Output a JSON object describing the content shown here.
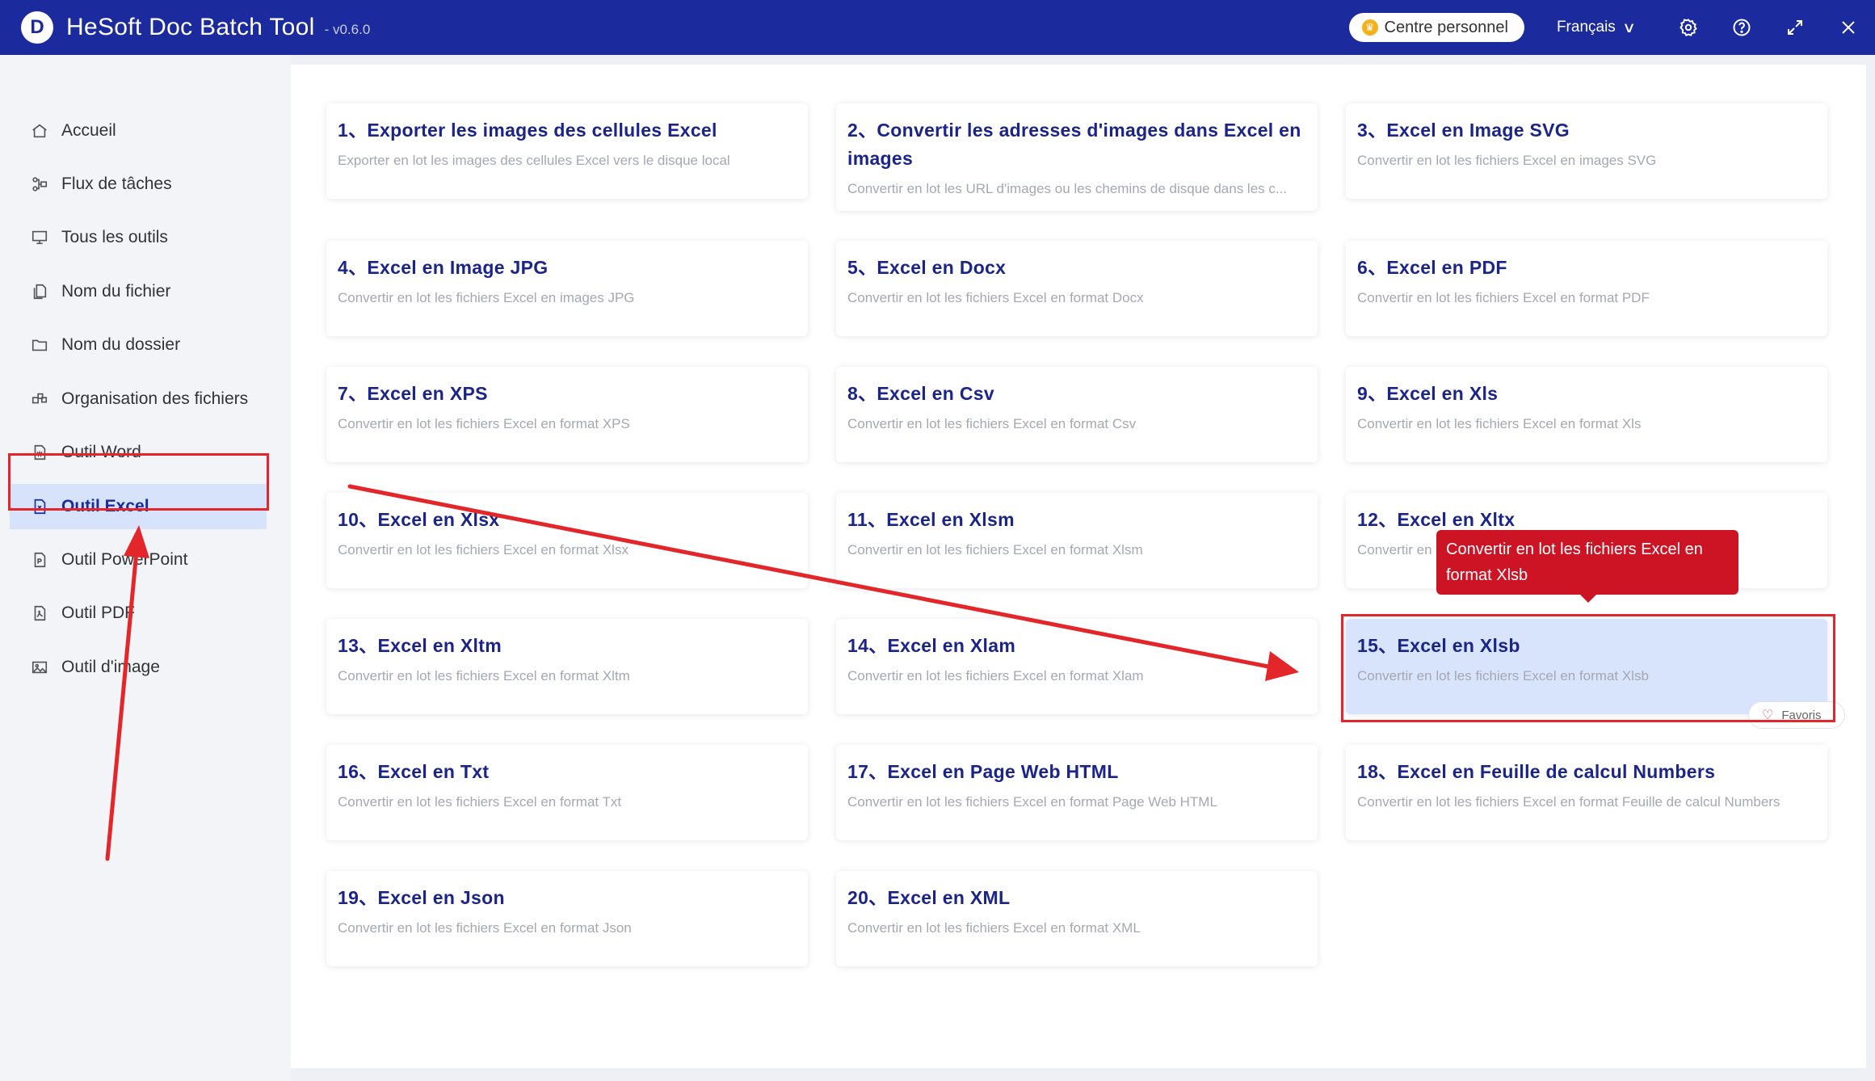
{
  "app": {
    "logo_letter": "D",
    "title": "HeSoft Doc Batch Tool",
    "version": "- v0.6.0",
    "centre_label": "Centre personnel",
    "language": "Français"
  },
  "sidebar": {
    "items": [
      {
        "label": "Accueil",
        "icon": "home-icon"
      },
      {
        "label": "Flux de tâches",
        "icon": "workflow-icon"
      },
      {
        "label": "Tous les outils",
        "icon": "monitor-icon"
      },
      {
        "label": "Nom du fichier",
        "icon": "file-copy-icon"
      },
      {
        "label": "Nom du dossier",
        "icon": "folder-icon"
      },
      {
        "label": "Organisation des fichiers",
        "icon": "organize-icon"
      },
      {
        "label": "Outil Word",
        "icon": "word-file-icon"
      },
      {
        "label": "Outil Excel",
        "icon": "excel-file-icon",
        "active": true
      },
      {
        "label": "Outil PowerPoint",
        "icon": "ppt-file-icon"
      },
      {
        "label": "Outil PDF",
        "icon": "pdf-file-icon"
      },
      {
        "label": "Outil d'image",
        "icon": "image-icon"
      }
    ]
  },
  "tools": [
    {
      "title": "1、Exporter les images des cellules Excel",
      "desc": "Exporter en lot les images des cellules Excel vers le disque local"
    },
    {
      "title": "2、Convertir les adresses d'images dans Excel en images",
      "desc": "Convertir en lot les URL d'images ou les chemins de disque dans les c..."
    },
    {
      "title": "3、Excel en Image SVG",
      "desc": "Convertir en lot les fichiers Excel en images SVG"
    },
    {
      "title": "4、Excel en Image JPG",
      "desc": "Convertir en lot les fichiers Excel en images JPG"
    },
    {
      "title": "5、Excel en Docx",
      "desc": "Convertir en lot les fichiers Excel en format Docx"
    },
    {
      "title": "6、Excel en PDF",
      "desc": "Convertir en lot les fichiers Excel en format PDF"
    },
    {
      "title": "7、Excel en XPS",
      "desc": "Convertir en lot les fichiers Excel en format XPS"
    },
    {
      "title": "8、Excel en Csv",
      "desc": "Convertir en lot les fichiers Excel en format Csv"
    },
    {
      "title": "9、Excel en Xls",
      "desc": "Convertir en lot les fichiers Excel en format Xls"
    },
    {
      "title": "10、Excel en Xlsx",
      "desc": "Convertir en lot les fichiers Excel en format Xlsx"
    },
    {
      "title": "11、Excel en Xlsm",
      "desc": "Convertir en lot les fichiers Excel en format Xlsm"
    },
    {
      "title": "12、Excel en Xltx",
      "desc": "Convertir en lot les fichiers Excel en format Xltx"
    },
    {
      "title": "13、Excel en Xltm",
      "desc": "Convertir en lot les fichiers Excel en format Xltm"
    },
    {
      "title": "14、Excel en Xlam",
      "desc": "Convertir en lot les fichiers Excel en format Xlam"
    },
    {
      "title": "15、Excel en Xlsb",
      "desc": "Convertir en lot les fichiers Excel en format Xlsb"
    },
    {
      "title": "16、Excel en Txt",
      "desc": "Convertir en lot les fichiers Excel en format Txt"
    },
    {
      "title": "17、Excel en Page Web HTML",
      "desc": "Convertir en lot les fichiers Excel en format Page Web HTML"
    },
    {
      "title": "18、Excel en Feuille de calcul Numbers",
      "desc": "Convertir en lot les fichiers Excel en format Feuille de calcul Numbers"
    },
    {
      "title": "19、Excel en Json",
      "desc": "Convertir en lot les fichiers Excel en format Json"
    },
    {
      "title": "20、Excel en XML",
      "desc": "Convertir en lot les fichiers Excel en format XML"
    }
  ],
  "favoris_label": "Favoris",
  "tooltip_text": "Convertir en lot les fichiers Excel en format Xlsb",
  "colors": {
    "titlebar": "#1b2a9c",
    "title_text": "#1b2589",
    "highlight": "#e3262a",
    "tooltip": "#cc1424",
    "active_bg": "#d7e3fb"
  }
}
